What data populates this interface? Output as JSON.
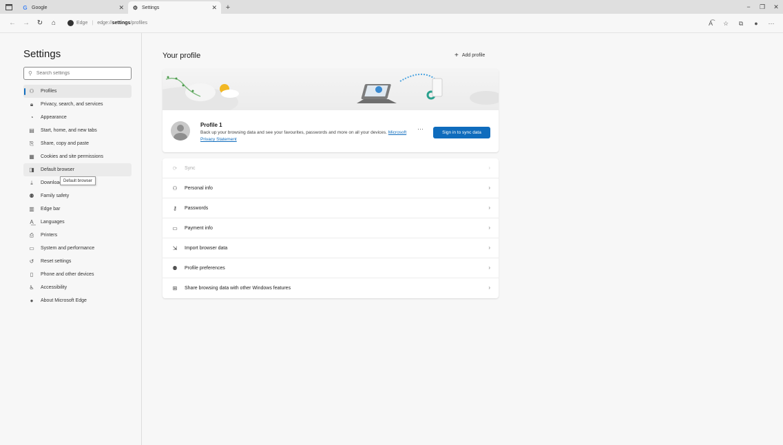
{
  "tabs": [
    {
      "title": "Google",
      "icon": "google-icon",
      "active": false
    },
    {
      "title": "Settings",
      "icon": "gear-icon",
      "active": true
    }
  ],
  "address": {
    "brand": "Edge",
    "url_prefix": "edge://",
    "url_bold": "settings",
    "url_suffix": "/profiles"
  },
  "sidebar": {
    "title": "Settings",
    "search_placeholder": "Search settings",
    "items": [
      {
        "label": "Profiles",
        "icon": "profile-icon"
      },
      {
        "label": "Privacy, search, and services",
        "icon": "lock-icon"
      },
      {
        "label": "Appearance",
        "icon": "appearance-icon"
      },
      {
        "label": "Start, home, and new tabs",
        "icon": "home-tabs-icon"
      },
      {
        "label": "Share, copy and paste",
        "icon": "share-icon"
      },
      {
        "label": "Cookies and site permissions",
        "icon": "cookies-icon"
      },
      {
        "label": "Default browser",
        "icon": "browser-icon"
      },
      {
        "label": "Downloads",
        "icon": "download-icon"
      },
      {
        "label": "Family safety",
        "icon": "family-icon"
      },
      {
        "label": "Edge bar",
        "icon": "edge-bar-icon"
      },
      {
        "label": "Languages",
        "icon": "languages-icon"
      },
      {
        "label": "Printers",
        "icon": "printer-icon"
      },
      {
        "label": "System and performance",
        "icon": "system-icon"
      },
      {
        "label": "Reset settings",
        "icon": "reset-icon"
      },
      {
        "label": "Phone and other devices",
        "icon": "phone-icon"
      },
      {
        "label": "Accessibility",
        "icon": "accessibility-icon"
      },
      {
        "label": "About Microsoft Edge",
        "icon": "edge-logo-icon"
      }
    ],
    "tooltip": "Default browser"
  },
  "main": {
    "title": "Your profile",
    "add_profile": "Add profile",
    "profile": {
      "name": "Profile 1",
      "desc": "Back up your browsing data and see your favourites, passwords and more on all your devices.",
      "link": "Microsoft Privacy Statement",
      "sync_button": "Sign in to sync data",
      "more": "···"
    },
    "rows": [
      {
        "label": "Sync",
        "icon": "sync-icon"
      },
      {
        "label": "Personal info",
        "icon": "personal-info-icon"
      },
      {
        "label": "Passwords",
        "icon": "key-icon"
      },
      {
        "label": "Payment info",
        "icon": "card-icon"
      },
      {
        "label": "Import browser data",
        "icon": "import-icon"
      },
      {
        "label": "Profile preferences",
        "icon": "profile-prefs-icon"
      },
      {
        "label": "Share browsing data with other Windows features",
        "icon": "windows-icon"
      }
    ]
  },
  "colors": {
    "accent": "#0f6cbd"
  }
}
